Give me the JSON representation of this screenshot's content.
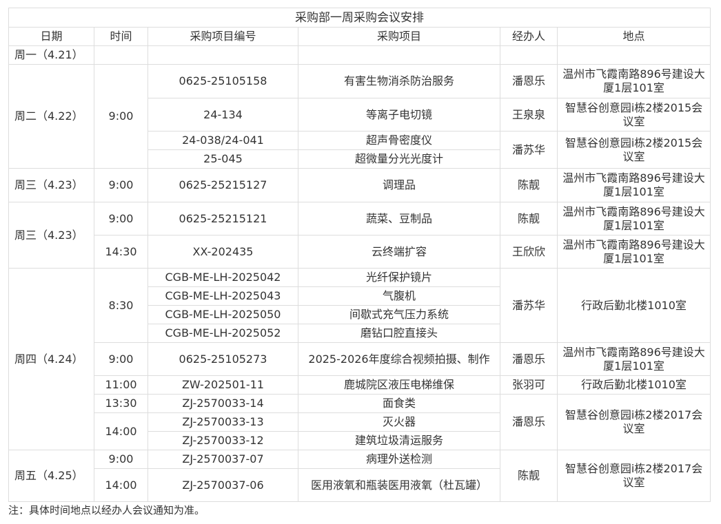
{
  "table_title": "采购部一周采购会议安排",
  "headers": {
    "date": "日期",
    "time": "时间",
    "project_no": "采购项目编号",
    "project": "采购项目",
    "handler": "经办人",
    "location": "地点"
  },
  "rows": [
    {
      "date": "周一（4.21）",
      "time": "",
      "no": "",
      "project": "",
      "handler": "",
      "location": ""
    },
    {
      "date": "周二（4.22）",
      "time": "9:00",
      "no": "0625-25105158",
      "project": "有害生物消杀防治服务",
      "handler": "潘恩乐",
      "location": "温州市飞霞南路896号建设大厦1层101室"
    },
    {
      "no": "24-134",
      "project": "等离子电切镜",
      "handler": "王泉泉",
      "location": "智慧谷创意园i栋2楼2015会议室"
    },
    {
      "no": "24-038/24-041",
      "project": "超声骨密度仪",
      "handler": "潘苏华",
      "location": "智慧谷创意园i栋2楼2015会议室"
    },
    {
      "no": "25-045",
      "project": "超微量分光光度计"
    },
    {
      "date": "周三（4.23）",
      "time": "9:00",
      "no": "0625-25215127",
      "project": "调理品",
      "handler": "陈靓",
      "location": "温州市飞霞南路896号建设大厦1层101室"
    },
    {
      "date": "周三（4.23）",
      "time": "9:00",
      "no": "0625-25215121",
      "project": "蔬菜、豆制品",
      "handler": "陈靓",
      "location": "温州市飞霞南路896号建设大厦1层101室"
    },
    {
      "time": "14:30",
      "no": "XX-202435",
      "project": "云终端扩容",
      "handler": "王欣欣",
      "location": "温州市飞霞南路896号建设大厦1层101室"
    },
    {
      "date": "周四（4.24）",
      "time": "8:30",
      "no": "CGB-ME-LH-2025042",
      "project": "光纤保护镜片",
      "handler": "潘苏华",
      "location": "行政后勤北楼1010室"
    },
    {
      "no": "CGB-ME-LH-2025043",
      "project": "气腹机"
    },
    {
      "no": "CGB-ME-LH-2025050",
      "project": "间歇式充气压力系统"
    },
    {
      "no": "CGB-ME-LH-2025052",
      "project": "磨钻口腔直接头"
    },
    {
      "time": "9:00",
      "no": "0625-25105273",
      "project": "2025-2026年度综合视频拍摄、制作",
      "handler": "潘恩乐",
      "location": "温州市飞霞南路896号建设大厦1层101室"
    },
    {
      "time": "11:00",
      "no": "ZW-202501-11",
      "project": "鹿城院区液压电梯维保",
      "handler": "张羽可",
      "location": "行政后勤北楼1010室"
    },
    {
      "time": "13:30",
      "no": "ZJ-2570033-14",
      "project": "面食类",
      "handler": "潘恩乐",
      "location": "智慧谷创意园i栋2楼2017会议室"
    },
    {
      "time": "14:00",
      "no": "ZJ-2570033-13",
      "project": "灭火器"
    },
    {
      "no": "ZJ-2570033-12",
      "project": "建筑垃圾清运服务"
    },
    {
      "date": "周五（4.25）",
      "time": "9:00",
      "no": "ZJ-2570037-07",
      "project": "病理外送检测",
      "handler": "陈靓",
      "location": "智慧谷创意园i栋2楼2017会议室"
    },
    {
      "time": "14:00",
      "no": "ZJ-2570037-06",
      "project": "医用液氧和瓶装医用液氧（杜瓦罐）"
    }
  ],
  "footnote": "注：具体时间地点以经办人会议通知为准。"
}
